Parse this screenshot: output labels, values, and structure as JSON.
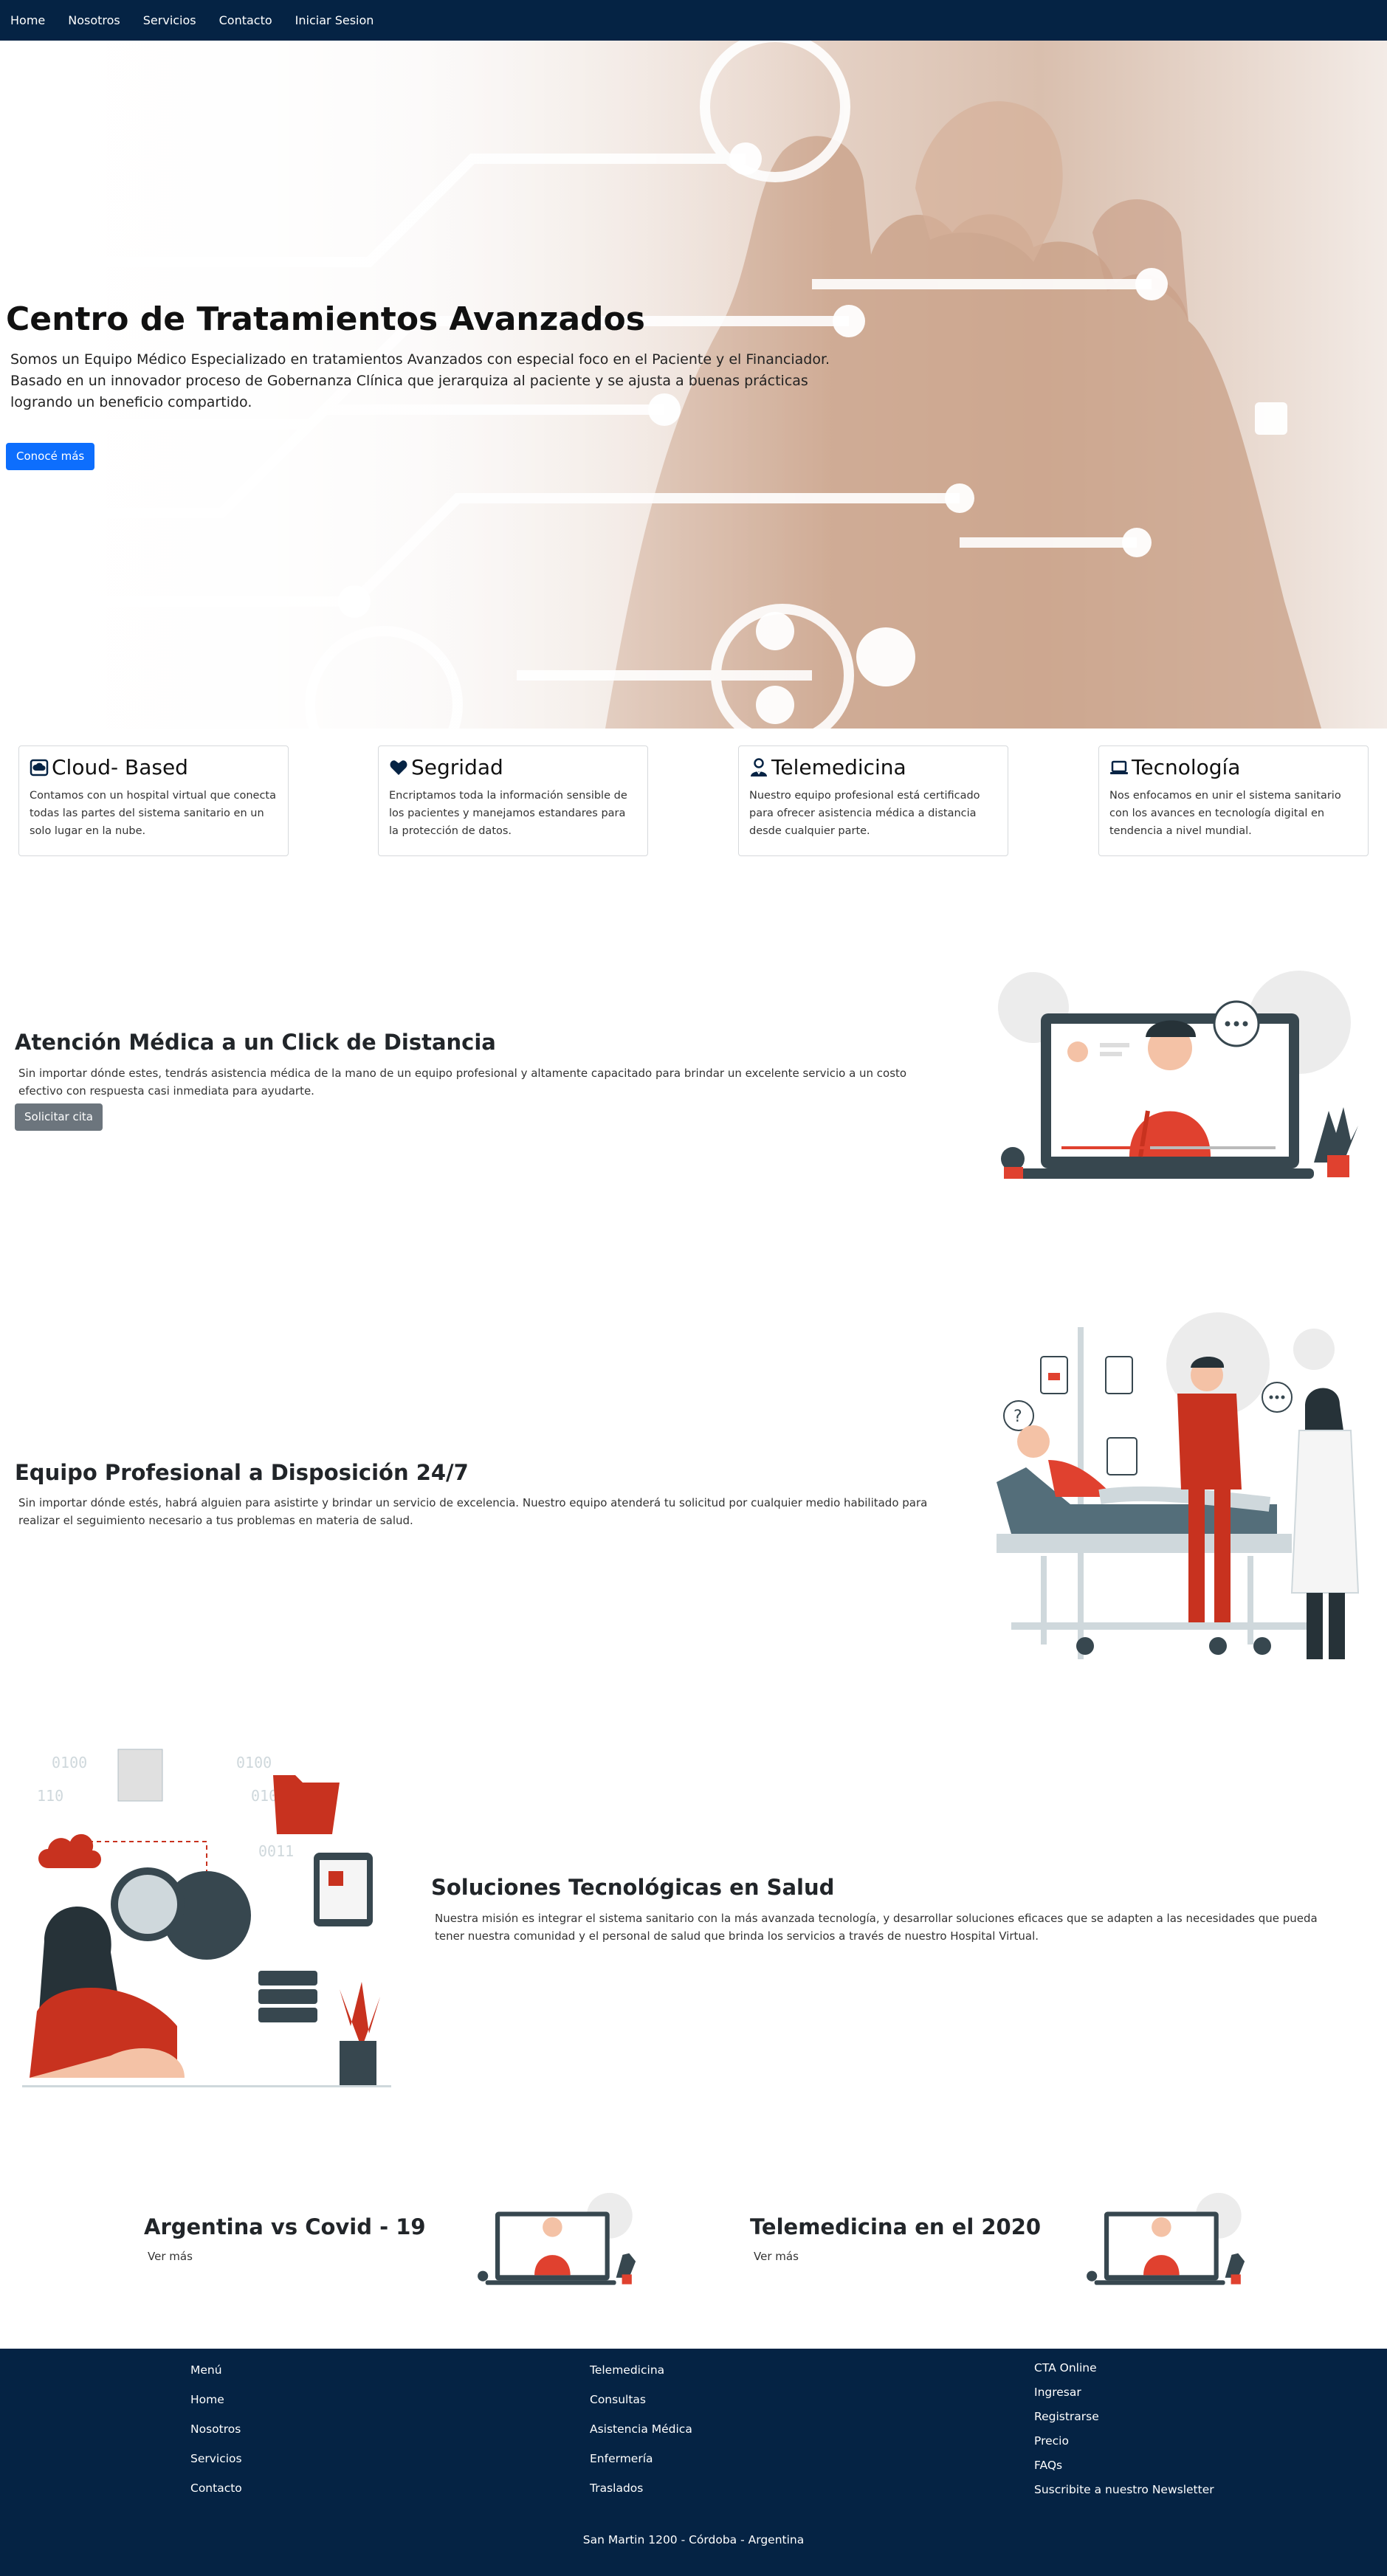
{
  "nav": {
    "items": [
      "Home",
      "Nosotros",
      "Servicios",
      "Contacto",
      "Iniciar Sesion"
    ]
  },
  "hero": {
    "title": "Centro de Tratamientos Avanzados",
    "text": "Somos un Equipo Médico Especializado en tratamientos Avanzados con especial foco en el Paciente y el Financiador. Basado en un innovador proceso de Gobernanza Clínica que jerarquiza al paciente y se ajusta a buenas prácticas logrando un beneficio compartido.",
    "button": "Conocé más"
  },
  "features": [
    {
      "icon": "cloud-icon",
      "title": "Cloud- Based",
      "text": "Contamos con un hospital virtual que conecta todas las partes del sistema sanitario en un solo lugar en la nube."
    },
    {
      "icon": "heart-icon",
      "title": "Segridad",
      "text": "Encriptamos toda la información sensible de los pacientes y manejamos estandares para la protección de datos."
    },
    {
      "icon": "doctor-icon",
      "title": "Telemedicina",
      "text": "Nuestro equipo profesional está certificado para ofrecer asistencia médica a distancia desde cualquier parte."
    },
    {
      "icon": "laptop-icon",
      "title": "Tecnología",
      "text": "Nos enfocamos en unir el sistema sanitario con los avances en tecnología digital en tendencia a nivel mundial."
    }
  ],
  "sections": {
    "atencion": {
      "title": "Atención Médica a un Click de Distancia",
      "text": "Sin importar dónde estes, tendrás asistencia médica de la mano de un equipo profesional y altamente capacitado para brindar un excelente servicio a un costo efectivo con respuesta casi inmediata para ayudarte.",
      "button": "Solicitar cita"
    },
    "equipo": {
      "title": "Equipo Profesional a Disposición 24/7",
      "text": "Sin importar dónde estés, habrá alguien para asistirte y brindar un servicio de excelencia. Nuestro equipo atenderá tu solicitud por cualquier medio habilitado para realizar el seguimiento necesario a tus problemas en materia de salud."
    },
    "soluciones": {
      "title": "Soluciones Tecnológicas en Salud",
      "text": "Nuestra misión es integrar el sistema sanitario con la más avanzada tecnología, y desarrollar soluciones eficaces que se adapten a las necesidades que pueda tener nuestra comunidad y el personal de salud que brinda los servicios a través de nuestro Hospital Virtual."
    }
  },
  "news": [
    {
      "title": "Argentina vs Covid - 19",
      "link": "Ver más"
    },
    {
      "title": "Telemedicina en el 2020",
      "link": "Ver más"
    }
  ],
  "footer": {
    "col1": [
      "Menú",
      "Home",
      "Nosotros",
      "Servicios",
      "Contacto"
    ],
    "col2": [
      "Telemedicina",
      "Consultas",
      "Asistencia Médica",
      "Enfermería",
      "Traslados"
    ],
    "col3": [
      "CTA Online",
      "Ingresar",
      "Registrarse",
      "Precio",
      "FAQs",
      "Suscribite a nuestro Newsletter"
    ],
    "address": "San Martin 1200 - Córdoba - Argentina"
  },
  "colors": {
    "navy": "#052344",
    "primary": "#0d6efd",
    "secondary": "#6c757d",
    "accent_red": "#e0412f"
  }
}
